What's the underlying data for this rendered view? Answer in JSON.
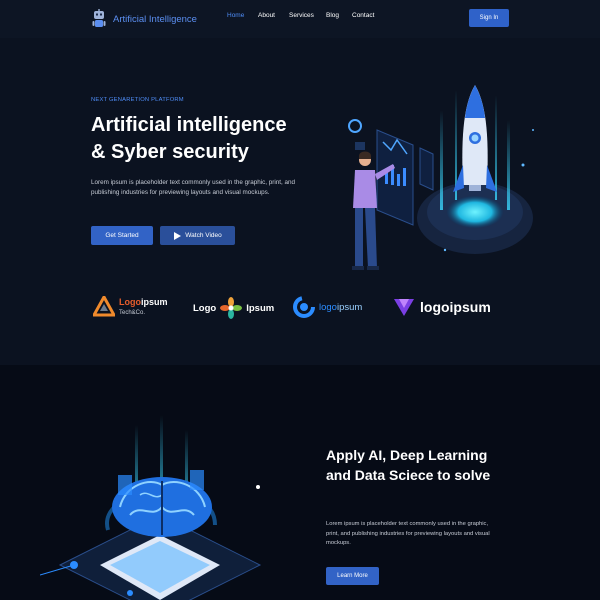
{
  "header": {
    "brand": "Artificial Intelligence",
    "nav": [
      {
        "label": "Home",
        "active": true
      },
      {
        "label": "About",
        "active": false
      },
      {
        "label": "Services",
        "active": false
      },
      {
        "label": "Blog",
        "active": false
      },
      {
        "label": "Contact",
        "active": false
      }
    ],
    "signin": "Sign In"
  },
  "hero": {
    "eyebrow": "NEXT GENARETION PLATFORM",
    "title_line1": "Artificial intelligence",
    "title_line2": "& Syber security",
    "description": "Lorem ipsum is placeholder text commonly used in the graphic, print, and publishing industries for previewing layouts and visual mockups.",
    "primary_button": "Get Started",
    "secondary_button": "Watch Video"
  },
  "logos": [
    {
      "name": "logoipsum-tech",
      "text_a": "Logo",
      "text_b": "ipsum",
      "sub": "Tech&Co."
    },
    {
      "name": "logo-ipsum-flower",
      "text_a": "Logo",
      "text_b": "Ipsum"
    },
    {
      "name": "logoipsum-blue",
      "text_a": "logo",
      "text_b": "ipsum"
    },
    {
      "name": "logoipsum-violet",
      "text_a": "logoipsum"
    }
  ],
  "section2": {
    "title_line1": "Apply AI, Deep Learning",
    "title_line2": "and Data Sciece to solve",
    "description": "Lorem ipsum is placeholder text commonly used in the graphic, print, and publishing industries for previewing layouts and visual mockups.",
    "button": "Learn More"
  },
  "colors": {
    "accent": "#4f8df7",
    "button": "#3263c6",
    "background": "#0b1220",
    "section_background": "#060b16"
  }
}
